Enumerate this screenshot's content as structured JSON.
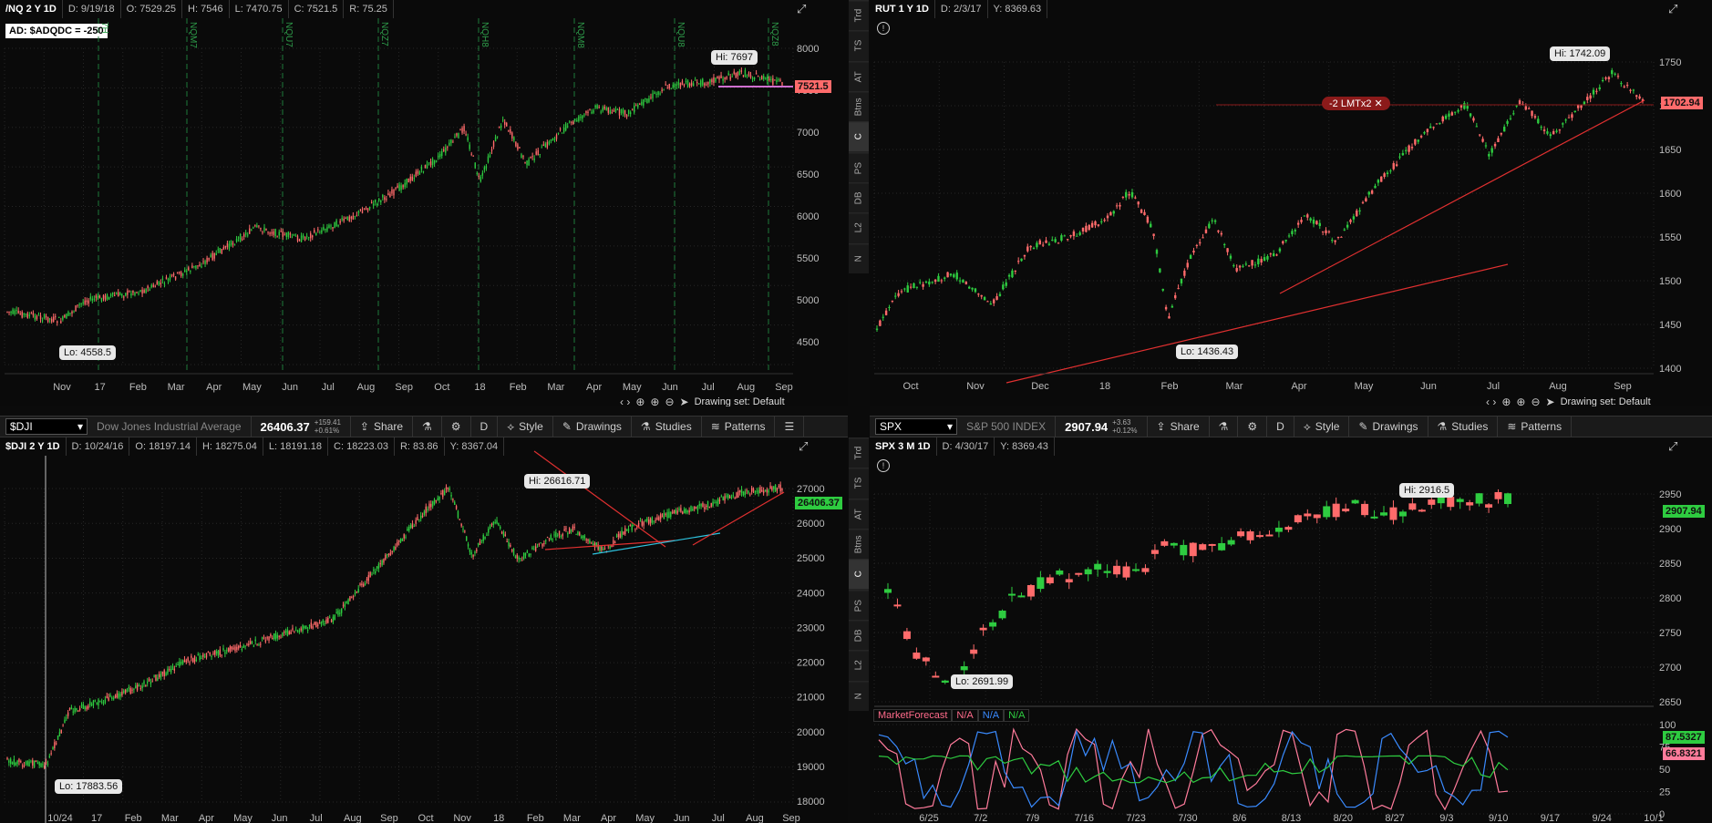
{
  "panel_tl": {
    "header": [
      "/NQ 2 Y 1D",
      "D: 9/19/18",
      "O: 7529.25",
      "H: 7546",
      "L: 7470.75",
      "C: 7521.5",
      "R: 75.25"
    ],
    "ad_label": "AD: $ADQDC = -250",
    "y_ticks": [
      "8000",
      "7500",
      "7000",
      "6500",
      "6000",
      "5500",
      "5000",
      "4500"
    ],
    "x_ticks": [
      "Nov",
      "17",
      "Feb",
      "Mar",
      "Apr",
      "May",
      "Jun",
      "Jul",
      "Aug",
      "Sep",
      "Oct",
      "18",
      "Feb",
      "Mar",
      "Apr",
      "May",
      "Jun",
      "Jul",
      "Aug",
      "Sep"
    ],
    "event_labels": [
      "7H",
      "NQM7",
      "NQU7",
      "NQZ7",
      "NQH8",
      "NQM8",
      "NQU8",
      "NQZ8"
    ],
    "hi": "Hi: 7697",
    "lo": "Lo: 4558.5",
    "last": "7521.5",
    "drawing_set": "Drawing set: Default"
  },
  "panel_tr": {
    "header": [
      "RUT 1 Y 1D",
      "D: 2/3/17",
      "Y: 8369.63"
    ],
    "y_ticks": [
      "1750",
      "1700",
      "1650",
      "1600",
      "1550",
      "1500",
      "1450",
      "1400"
    ],
    "x_ticks": [
      "Oct",
      "Nov",
      "Dec",
      "18",
      "Feb",
      "Mar",
      "Apr",
      "May",
      "Jun",
      "Jul",
      "Aug",
      "Sep"
    ],
    "hi": "Hi: 1742.09",
    "lo": "Lo: 1436.43",
    "last": "1702.94",
    "order": "-2 LMTx2",
    "drawing_set": "Drawing set: Default",
    "side_tabs": [
      "Trd",
      "TS",
      "AT",
      "Btns",
      "C",
      "PS",
      "DB",
      "L2",
      "N"
    ]
  },
  "toolbar_left": {
    "symbol": "$DJI",
    "name": "Dow Jones Industrial Average",
    "price": "26406.37",
    "chg": "+159.41",
    "chg_pct": "+0.61%",
    "share": "Share",
    "period": "D",
    "style": "Style",
    "drawings": "Drawings",
    "studies": "Studies",
    "patterns": "Patterns"
  },
  "toolbar_right": {
    "symbol": "SPX",
    "name": "S&P 500 INDEX",
    "price": "2907.94",
    "chg": "+3.63",
    "chg_pct": "+0.12%",
    "share": "Share",
    "period": "D",
    "style": "Style",
    "drawings": "Drawings",
    "studies": "Studies",
    "patterns": "Patterns"
  },
  "panel_bl": {
    "header": [
      "$DJI 2 Y 1D",
      "D: 10/24/16",
      "O: 18197.14",
      "H: 18275.04",
      "L: 18191.18",
      "C: 18223.03",
      "R: 83.86",
      "Y: 8367.04"
    ],
    "y_ticks": [
      "27000",
      "26000",
      "25000",
      "24000",
      "23000",
      "22000",
      "21000",
      "20000",
      "19000",
      "18000"
    ],
    "x_ticks": [
      "10/24",
      "17",
      "Feb",
      "Mar",
      "Apr",
      "May",
      "Jun",
      "Jul",
      "Aug",
      "Sep",
      "Oct",
      "Nov",
      "18",
      "Feb",
      "Mar",
      "Apr",
      "May",
      "Jun",
      "Jul",
      "Aug",
      "Sep"
    ],
    "hi": "Hi: 26616.71",
    "lo": "Lo: 17883.56",
    "last": "26406.37"
  },
  "panel_br": {
    "header": [
      "SPX 3 M 1D",
      "D: 4/30/17",
      "Y: 8369.43"
    ],
    "y_ticks": [
      "2950",
      "2900",
      "2850",
      "2800",
      "2750",
      "2700",
      "2650"
    ],
    "x_ticks": [
      "6/25",
      "7/2",
      "7/9",
      "7/16",
      "7/23",
      "7/30",
      "8/6",
      "8/13",
      "8/20",
      "8/27",
      "9/3",
      "9/10",
      "9/17",
      "9/24",
      "10/1"
    ],
    "hi": "Hi: 2916.5",
    "lo": "Lo: 2691.99",
    "last": "2907.94",
    "side_tabs": [
      "Trd",
      "TS",
      "AT",
      "Btns",
      "C",
      "PS",
      "DB",
      "L2",
      "N"
    ],
    "study": {
      "name": "MarketForecast",
      "vals": [
        "N/A",
        "N/A",
        "N/A"
      ],
      "y_ticks": [
        "100",
        "75",
        "50",
        "25",
        "0"
      ],
      "last1": "87.5327",
      "last2": "66.8321"
    }
  },
  "colors": {
    "up": "#2ecc40",
    "down": "#ff5b5b",
    "bg": "#0a0a0a",
    "grid": "#2a2a2a",
    "accent": "#d03a3a"
  }
}
